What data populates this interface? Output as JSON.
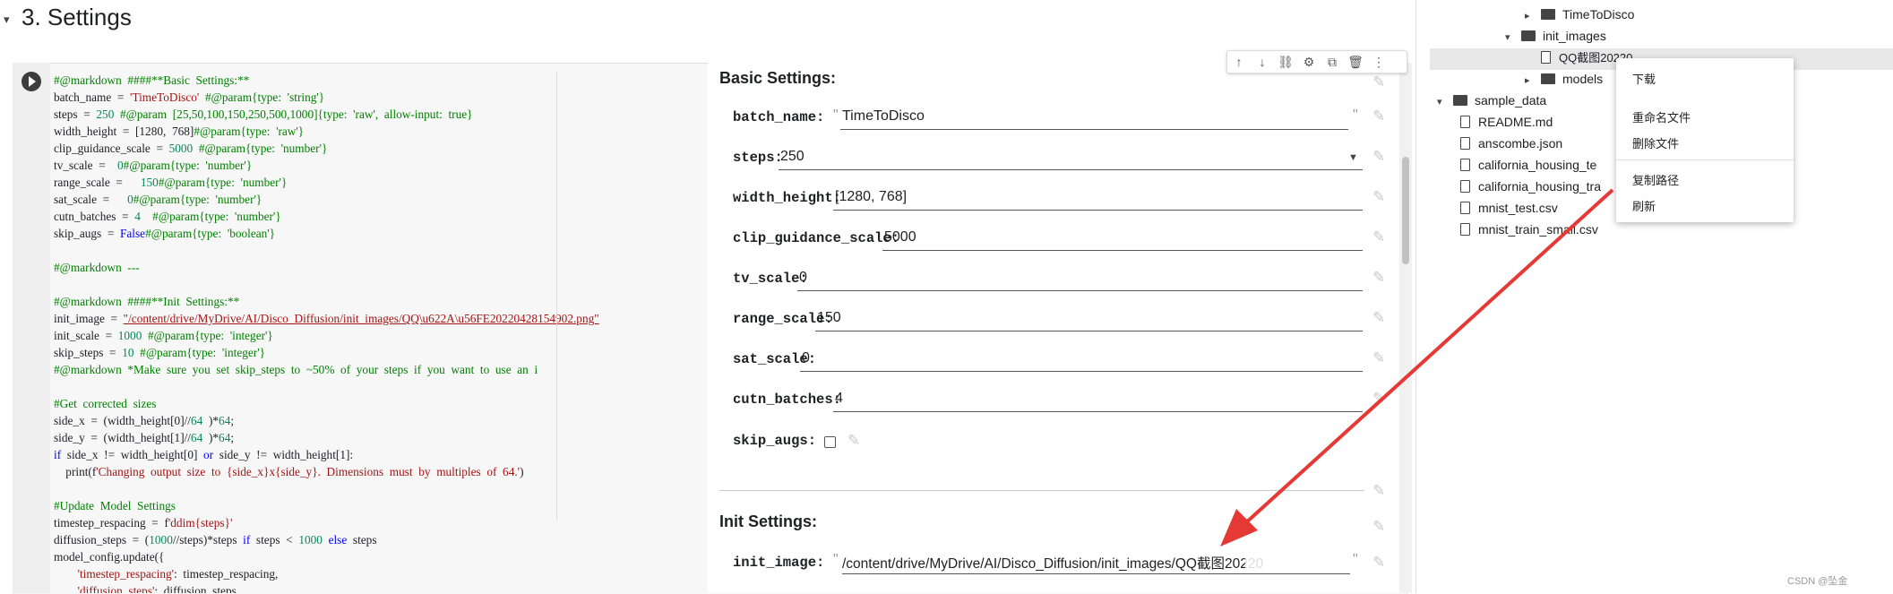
{
  "section": {
    "caret": "▾",
    "title": "3. Settings"
  },
  "code_lines": [
    {
      "parts": [
        [
          "cm",
          "#@markdown  ####**Basic  Settings:**"
        ]
      ]
    },
    {
      "parts": [
        [
          "",
          "batch_name  =  "
        ],
        [
          "str",
          "'TimeToDisco'"
        ],
        [
          "cm",
          "  #@param{type:  'string'}"
        ]
      ]
    },
    {
      "parts": [
        [
          "",
          "steps  =  "
        ],
        [
          "num",
          "250"
        ],
        [
          "cm",
          "  #@param  [25,50,100,150,250,500,1000]{type:  'raw',  allow-input:  true}"
        ]
      ]
    },
    {
      "parts": [
        [
          "",
          "width_height  =  [1280,  768]"
        ],
        [
          "cm",
          "#@param{type:  'raw'}"
        ]
      ]
    },
    {
      "parts": [
        [
          "",
          "clip_guidance_scale  =  "
        ],
        [
          "num",
          "5000"
        ],
        [
          "cm",
          "  #@param{type:  'number'}"
        ]
      ]
    },
    {
      "parts": [
        [
          "",
          "tv_scale  =    "
        ],
        [
          "num",
          "0"
        ],
        [
          "cm",
          "#@param{type:  'number'}"
        ]
      ]
    },
    {
      "parts": [
        [
          "",
          "range_scale  =      "
        ],
        [
          "num",
          "150"
        ],
        [
          "cm",
          "#@param{type:  'number'}"
        ]
      ]
    },
    {
      "parts": [
        [
          "",
          "sat_scale  =      "
        ],
        [
          "num",
          "0"
        ],
        [
          "cm",
          "#@param{type:  'number'}"
        ]
      ]
    },
    {
      "parts": [
        [
          "",
          "cutn_batches  =  "
        ],
        [
          "num",
          "4"
        ],
        [
          "cm",
          "    #@param{type:  'number'}"
        ]
      ]
    },
    {
      "parts": [
        [
          "",
          "skip_augs  =  "
        ],
        [
          "kw",
          "False"
        ],
        [
          "cm",
          "#@param{type:  'boolean'}"
        ]
      ]
    },
    {
      "parts": [
        [
          "",
          ""
        ]
      ]
    },
    {
      "parts": [
        [
          "cm",
          "#@markdown  ---"
        ]
      ]
    },
    {
      "parts": [
        [
          "",
          ""
        ]
      ]
    },
    {
      "parts": [
        [
          "cm",
          "#@markdown  ####**Init  Settings:**"
        ]
      ]
    },
    {
      "parts": [
        [
          "",
          "init_image  =  "
        ],
        [
          "lnk",
          "\"/content/drive/MyDrive/AI/Disco_Diffusion/init_images/QQ\\u622A\\u56FE20220428154902.png\""
        ]
      ]
    },
    {
      "parts": [
        [
          "",
          "init_scale  =  "
        ],
        [
          "num",
          "1000"
        ],
        [
          "cm",
          "  #@param{type:  'integer'}"
        ]
      ]
    },
    {
      "parts": [
        [
          "",
          "skip_steps  =  "
        ],
        [
          "num",
          "10"
        ],
        [
          "cm",
          "  #@param{type:  'integer'}"
        ]
      ]
    },
    {
      "parts": [
        [
          "cm",
          "#@markdown  *Make  sure  you  set  skip_steps  to  ~50%  of  your  steps  if  you  want  to  use  an  i"
        ]
      ]
    },
    {
      "parts": [
        [
          "",
          ""
        ]
      ]
    },
    {
      "parts": [
        [
          "cm",
          "#Get  corrected  sizes"
        ]
      ]
    },
    {
      "parts": [
        [
          "",
          "side_x  =  (width_height[0]//"
        ],
        [
          "num",
          "64"
        ],
        [
          "",
          "  )*"
        ],
        [
          "num",
          "64"
        ],
        [
          "",
          ";"
        ]
      ]
    },
    {
      "parts": [
        [
          "",
          "side_y  =  (width_height[1]//"
        ],
        [
          "num",
          "64"
        ],
        [
          "",
          "  )*"
        ],
        [
          "num",
          "64"
        ],
        [
          "",
          ";"
        ]
      ]
    },
    {
      "parts": [
        [
          "kw",
          "if"
        ],
        [
          "",
          "  side_x  !=  width_height[0]  "
        ],
        [
          "kw",
          "or"
        ],
        [
          "",
          "  side_y  !=  width_height[1]:"
        ]
      ]
    },
    {
      "parts": [
        [
          "",
          "    print(f"
        ],
        [
          "str",
          "'Changing  output  size  to  {side_x}x{side_y}.  Dimensions  must  by  multiples  of  64.'"
        ],
        [
          "",
          ")"
        ]
      ]
    },
    {
      "parts": [
        [
          "",
          ""
        ]
      ]
    },
    {
      "parts": [
        [
          "cm",
          "#Update  Model  Settings"
        ]
      ]
    },
    {
      "parts": [
        [
          "",
          "timestep_respacing  =  f"
        ],
        [
          "str",
          "'ddim{steps}'"
        ]
      ]
    },
    {
      "parts": [
        [
          "",
          "diffusion_steps  =  ("
        ],
        [
          "num",
          "1000"
        ],
        [
          "",
          "//steps)*steps  "
        ],
        [
          "kw",
          "if"
        ],
        [
          "",
          "  steps  <  "
        ],
        [
          "num",
          "1000"
        ],
        [
          "",
          "  "
        ],
        [
          "kw",
          "else"
        ],
        [
          "",
          "  steps"
        ]
      ]
    },
    {
      "parts": [
        [
          "",
          "model_config.update({"
        ]
      ]
    },
    {
      "parts": [
        [
          "",
          "        "
        ],
        [
          "str",
          "'timestep_respacing'"
        ],
        [
          "",
          ":  timestep_respacing,"
        ]
      ]
    },
    {
      "parts": [
        [
          "",
          "        "
        ],
        [
          "str",
          "'diffusion_steps'"
        ],
        [
          "",
          ":  diffusion_steps,"
        ]
      ]
    }
  ],
  "form": {
    "basic_heading": "Basic Settings:",
    "init_heading": "Init Settings:",
    "fields": [
      {
        "label": "batch_name:",
        "value": "TimeToDisco"
      },
      {
        "label": "steps:",
        "value": "250"
      },
      {
        "label": "width_height:",
        "value": "[1280, 768]"
      },
      {
        "label": "clip_guidance_scale:",
        "value": "5000"
      },
      {
        "label": "tv_scale:",
        "value": "0"
      },
      {
        "label": "range_scale:",
        "value": "150"
      },
      {
        "label": "sat_scale:",
        "value": "0"
      },
      {
        "label": "cutn_batches:",
        "value": "4"
      },
      {
        "label": "skip_augs:",
        "value": ""
      }
    ],
    "init_image": {
      "label": "init_image:",
      "value": "/content/drive/MyDrive/AI/Disco_Diffusion/init_images/QQ截图20220"
    }
  },
  "toolbar_icons": [
    "↑",
    "↓",
    "⛓",
    "⚙",
    "⧉",
    "🗑",
    "⋮"
  ],
  "file_tree": {
    "rows": [
      {
        "name": "TimeToDisco",
        "type": "folder",
        "expand": "▸"
      },
      {
        "name": "init_images",
        "type": "folder",
        "expand": "▾"
      },
      {
        "name": "QQ截图20220",
        "type": "file",
        "expand": ""
      },
      {
        "name": "models",
        "type": "folder",
        "expand": "▸"
      },
      {
        "name": "sample_data",
        "type": "folder",
        "expand": "▾"
      },
      {
        "name": "README.md",
        "type": "file",
        "expand": ""
      },
      {
        "name": "anscombe.json",
        "type": "file",
        "expand": ""
      },
      {
        "name": "california_housing_te",
        "type": "file",
        "expand": ""
      },
      {
        "name": "california_housing_tra",
        "type": "file",
        "expand": ""
      },
      {
        "name": "mnist_test.csv",
        "type": "file",
        "expand": ""
      },
      {
        "name": "mnist_train_small.csv",
        "type": "file",
        "expand": ""
      }
    ]
  },
  "context_menu": {
    "items": [
      "下载",
      "重命名文件",
      "删除文件",
      "复制路径",
      "刷新"
    ]
  },
  "watermark": "CSDN @坠金",
  "colors": {
    "arrow": "#e53935",
    "accent": "#1a73e8"
  }
}
